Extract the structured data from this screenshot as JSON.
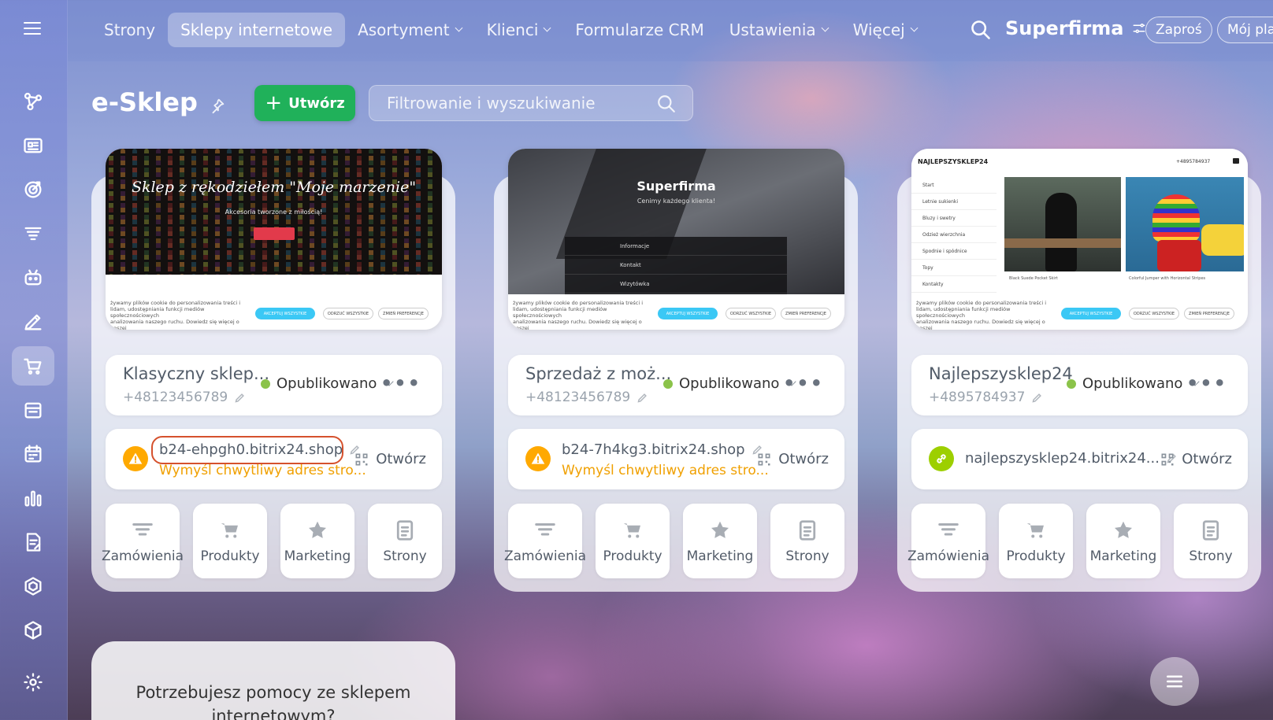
{
  "nav": {
    "items": [
      {
        "label": "Strony",
        "dropdown": false,
        "active": false
      },
      {
        "label": "Sklepy internetowe",
        "dropdown": false,
        "active": true
      },
      {
        "label": "Asortyment",
        "dropdown": true,
        "active": false
      },
      {
        "label": "Klienci",
        "dropdown": true,
        "active": false
      },
      {
        "label": "Formularze CRM",
        "dropdown": false,
        "active": false
      },
      {
        "label": "Ustawienia",
        "dropdown": true,
        "active": false
      },
      {
        "label": "Więcej",
        "dropdown": true,
        "active": false
      }
    ],
    "brand": "Superfirma",
    "invite": "Zaproś",
    "my_plan": "Mój pla"
  },
  "page": {
    "title": "e-Sklep",
    "create_label": "Utwórz",
    "filter_placeholder": "Filtrowanie i wyszukiwanie"
  },
  "shops": [
    {
      "name": "Klasyczny sklep...",
      "phone": "+48123456789",
      "status": "Opublikowano",
      "url": "b24-ehpgh0.bitrix24.shop",
      "url_hint": "Wymyśl chwytliwy adres stro...",
      "url_state": "warning",
      "open_label": "Otwórz",
      "preview": {
        "headline": "Sklep z rękodziełem \"Moje marzenie\"",
        "sub": "Akcesoria tworzone z miłością!"
      }
    },
    {
      "name": "Sprzedaż z moż...",
      "phone": "+48123456789",
      "status": "Opublikowano",
      "url": "b24-7h4kg3.bitrix24.shop",
      "url_hint": "Wymyśl chwytliwy adres stro...",
      "url_state": "warning",
      "open_label": "Otwórz",
      "preview": {
        "headline": "Superfirma",
        "sub": "Cenimy każdego klienta!",
        "menu": [
          "Informacje",
          "Kontakt",
          "Wizytówka"
        ]
      }
    },
    {
      "name": "Najlepszysklep24",
      "phone": "+4895784937",
      "status": "Opublikowano",
      "url": "najlepszysklep24.bitrix24...",
      "url_hint": "",
      "url_state": "ok",
      "open_label": "Otwórz",
      "preview": {
        "headline": "NAJLEPSZYSKLEP24",
        "phone": "+4895784937",
        "menu": [
          "Start",
          "Letnie sukienki",
          "Bluzy i swetry",
          "Odzież wierzchnia",
          "Spodnie i spódnice",
          "Topy",
          "Kontakty"
        ],
        "products": [
          "Black Suede Pocket Skirt",
          "Colorful Jumper with Horizontal Stripes"
        ]
      }
    }
  ],
  "tiles": [
    "Zamówienia",
    "Produkty",
    "Marketing",
    "Strony"
  ],
  "cookie": {
    "text": "żywamy plików cookie do personalizowania treści i\nlidam, udostępniania funkcji mediów społecznościowych\nanalizowania naszego ruchu. Dowiedz się więcej o naszej\nlityce plików cookie.",
    "accept": "AKCEPTUJ WSZYSTKIE",
    "reject": "ODRZUĆ WSZYSTKIE",
    "prefs": "ZMIEŃ PREFERENCJE"
  },
  "help": {
    "text": "Potrzebujesz pomocy ze sklepem internetowym?"
  },
  "colors": {
    "accent_green": "#20b15a",
    "warning": "#ffa900",
    "published_dot": "#8bc34a",
    "highlight": "#d5512d"
  }
}
